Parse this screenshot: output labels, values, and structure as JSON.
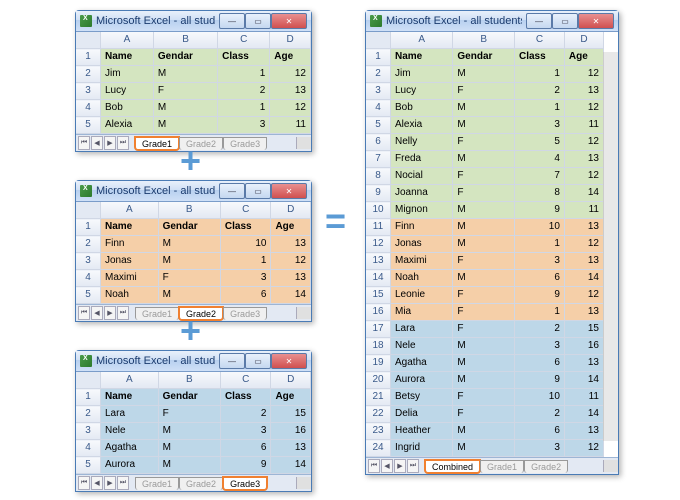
{
  "window_title": "Microsoft Excel - all students inf...",
  "columns": [
    "A",
    "B",
    "C",
    "D"
  ],
  "headers": [
    "Name",
    "Gendar",
    "Class",
    "Age"
  ],
  "nav": [
    "⏮",
    "◀",
    "▶",
    "⏭"
  ],
  "win_min": "—",
  "win_max": "▭",
  "win_close": "✕",
  "grade1_rows": [
    [
      "Jim",
      "M",
      "1",
      "12"
    ],
    [
      "Lucy",
      "F",
      "2",
      "13"
    ],
    [
      "Bob",
      "M",
      "1",
      "12"
    ],
    [
      "Alexia",
      "M",
      "3",
      "11"
    ]
  ],
  "grade2_rows": [
    [
      "Finn",
      "M",
      "10",
      "13"
    ],
    [
      "Jonas",
      "M",
      "1",
      "12"
    ],
    [
      "Maximi",
      "F",
      "3",
      "13"
    ],
    [
      "Noah",
      "M",
      "6",
      "14"
    ]
  ],
  "grade3_rows": [
    [
      "Lara",
      "F",
      "2",
      "15"
    ],
    [
      "Nele",
      "M",
      "3",
      "16"
    ],
    [
      "Agatha",
      "M",
      "6",
      "13"
    ],
    [
      "Aurora",
      "M",
      "9",
      "14"
    ]
  ],
  "combined_rows": [
    [
      "Jim",
      "M",
      "1",
      "12",
      "g"
    ],
    [
      "Lucy",
      "F",
      "2",
      "13",
      "g"
    ],
    [
      "Bob",
      "M",
      "1",
      "12",
      "g"
    ],
    [
      "Alexia",
      "M",
      "3",
      "11",
      "g"
    ],
    [
      "Nelly",
      "F",
      "5",
      "12",
      "g"
    ],
    [
      "Freda",
      "M",
      "4",
      "13",
      "g"
    ],
    [
      "Nocial",
      "F",
      "7",
      "12",
      "g"
    ],
    [
      "Joanna",
      "F",
      "8",
      "14",
      "g"
    ],
    [
      "Mignon",
      "M",
      "9",
      "11",
      "g"
    ],
    [
      "Finn",
      "M",
      "10",
      "13",
      "o"
    ],
    [
      "Jonas",
      "M",
      "1",
      "12",
      "o"
    ],
    [
      "Maximi",
      "F",
      "3",
      "13",
      "o"
    ],
    [
      "Noah",
      "M",
      "6",
      "14",
      "o"
    ],
    [
      "Leonie",
      "F",
      "9",
      "12",
      "o"
    ],
    [
      "Mia",
      "F",
      "1",
      "13",
      "o"
    ],
    [
      "Lara",
      "F",
      "2",
      "15",
      "b"
    ],
    [
      "Nele",
      "M",
      "3",
      "16",
      "b"
    ],
    [
      "Agatha",
      "M",
      "6",
      "13",
      "b"
    ],
    [
      "Aurora",
      "M",
      "9",
      "14",
      "b"
    ],
    [
      "Betsy",
      "F",
      "10",
      "11",
      "b"
    ],
    [
      "Delia",
      "F",
      "2",
      "14",
      "b"
    ],
    [
      "Heather",
      "M",
      "6",
      "13",
      "b"
    ],
    [
      "Ingrid",
      "M",
      "3",
      "12",
      "b"
    ]
  ],
  "tabs_small": [
    "Grade1",
    "Grade2",
    "Grade3"
  ],
  "tabs_combined": [
    "Combined",
    "Grade1",
    "Grade2"
  ],
  "plus": "+",
  "equals": "="
}
